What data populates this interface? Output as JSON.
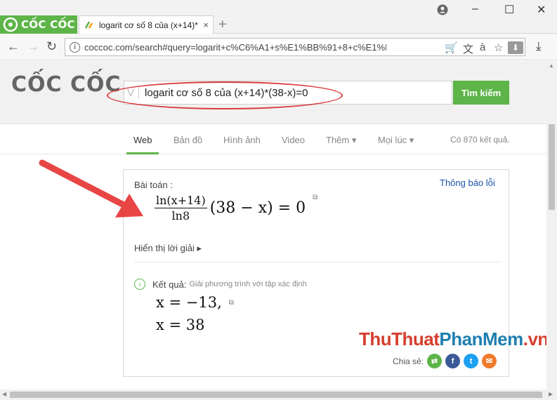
{
  "browser": {
    "brand": "CỐC CỐC",
    "tab_title": "logarit cơ số 8 của (x+14)*",
    "tab_close": "×",
    "new_tab": "+",
    "url": "coccoc.com/search#query=logarit+c%C6%A1+s%E1%BB%91+8+c%E1%BB%A7..."
  },
  "search": {
    "logo": "CỐC CỐC",
    "query": "logarit cơ số 8 của (x+14)*(38-x)=0",
    "button_label": "Tìm kiếm"
  },
  "tabs": [
    {
      "label": "Web"
    },
    {
      "label": "Bản đồ"
    },
    {
      "label": "Hình ảnh"
    },
    {
      "label": "Video"
    },
    {
      "label": "Thêm"
    },
    {
      "label": "Mọi lúc"
    }
  ],
  "result_count": "Có 870 kết quả.",
  "math": {
    "problem_label": "Bài toán :",
    "report_link": "Thông báo lỗi",
    "numerator": "ln(x+14)",
    "denominator": "ln8",
    "equation_rest": "(38 − x) = 0",
    "show_solution": "Hiển thị lời giải ▸",
    "result_label": "Kết quả:",
    "result_note": "Giải phương trình với tập xác định",
    "answer_1": "x = −13,",
    "answer_2": "x = 38",
    "share_label": "Chia sẻ:"
  },
  "watermark": {
    "part1": "ThuThuat",
    "part2": "PhanMem",
    "part3": ".vn"
  },
  "colors": {
    "brand_green": "#5db448",
    "highlight_red": "#d93b3b",
    "link_blue": "#1a53a8"
  }
}
